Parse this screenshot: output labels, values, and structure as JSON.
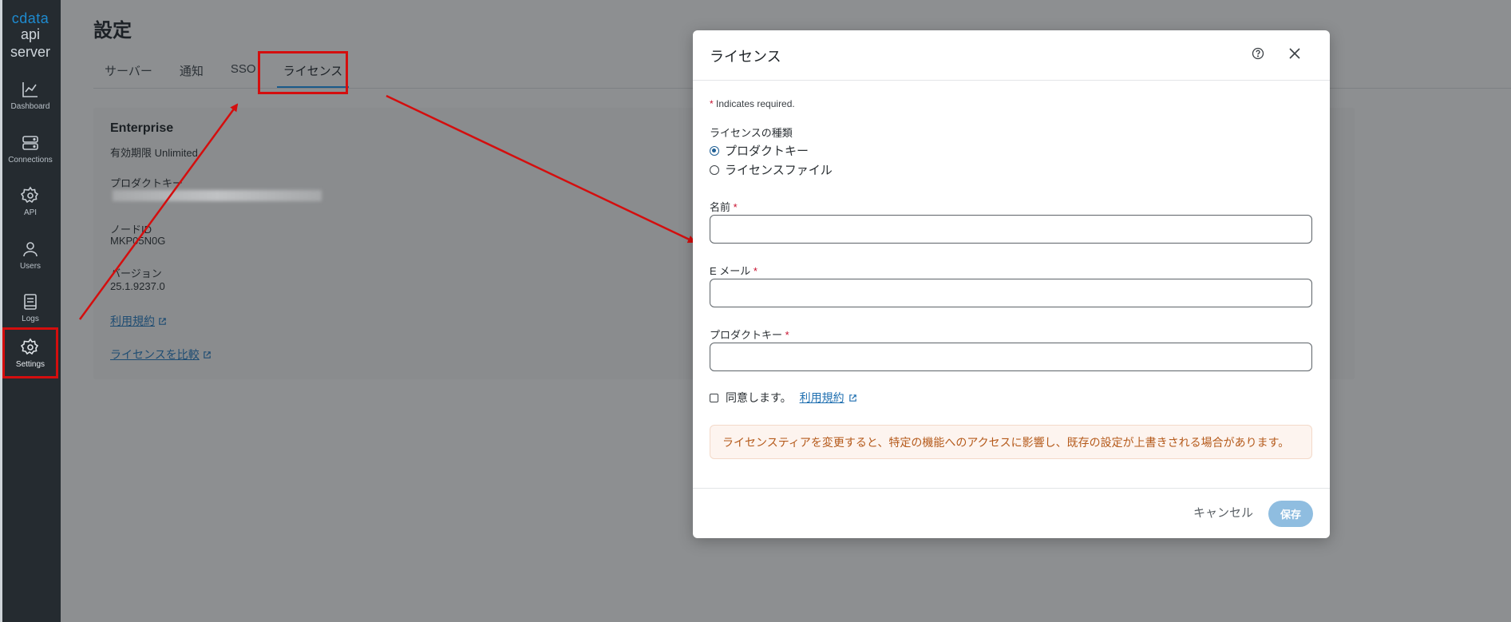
{
  "sidebar": {
    "logo_line1": "cdata",
    "logo_line2": "api server",
    "items": [
      {
        "label": "Dashboard",
        "icon": "chart-line-icon"
      },
      {
        "label": "Connections",
        "icon": "server-icon"
      },
      {
        "label": "API",
        "icon": "gear-cog-icon"
      },
      {
        "label": "Users",
        "icon": "user-icon"
      },
      {
        "label": "Logs",
        "icon": "book-icon"
      },
      {
        "label": "Settings",
        "icon": "settings-icon",
        "selected": true
      }
    ]
  },
  "page": {
    "title": "設定",
    "tabs": [
      {
        "label": "サーバー"
      },
      {
        "label": "通知"
      },
      {
        "label": "SSO"
      },
      {
        "label": "ライセンス",
        "active": true
      }
    ]
  },
  "license_card": {
    "edition": "Enterprise",
    "expiry": "有効期限 Unlimited",
    "product_key_label": "プロダクトキー",
    "node_id_label": "ノードID",
    "node_id": "MKP05N0G",
    "version_label": "バージョン",
    "version": "25.1.9237.0",
    "terms_link": "利用規約",
    "compare_link": "ライセンスを比較"
  },
  "modal": {
    "title": "ライセンス",
    "required_note": "Indicates required.",
    "required_star": "*",
    "license_type_label": "ライセンスの種類",
    "license_type_options": [
      {
        "label": "プロダクトキー",
        "selected": true
      },
      {
        "label": "ライセンスファイル",
        "selected": false
      }
    ],
    "name_label": "名前",
    "name_value": "",
    "email_label": "E メール",
    "email_value": "",
    "product_key_label": "プロダクトキー",
    "product_key_value": "",
    "agree_text": "同意します。",
    "agree_link": "利用規約",
    "agree_checked": false,
    "warning": "ライセンスティアを変更すると、特定の機能へのアクセスに影響し、既存の設定が上書きされる場合があります。",
    "cancel_label": "キャンセル",
    "save_label": "保存"
  },
  "colors": {
    "annotation_red": "#d40e0e",
    "sidebar_bg": "#252b30",
    "overlay_bg": "#8d8f91",
    "primary_disabled": "#8fbde0",
    "warning_text": "#b55a1b"
  }
}
